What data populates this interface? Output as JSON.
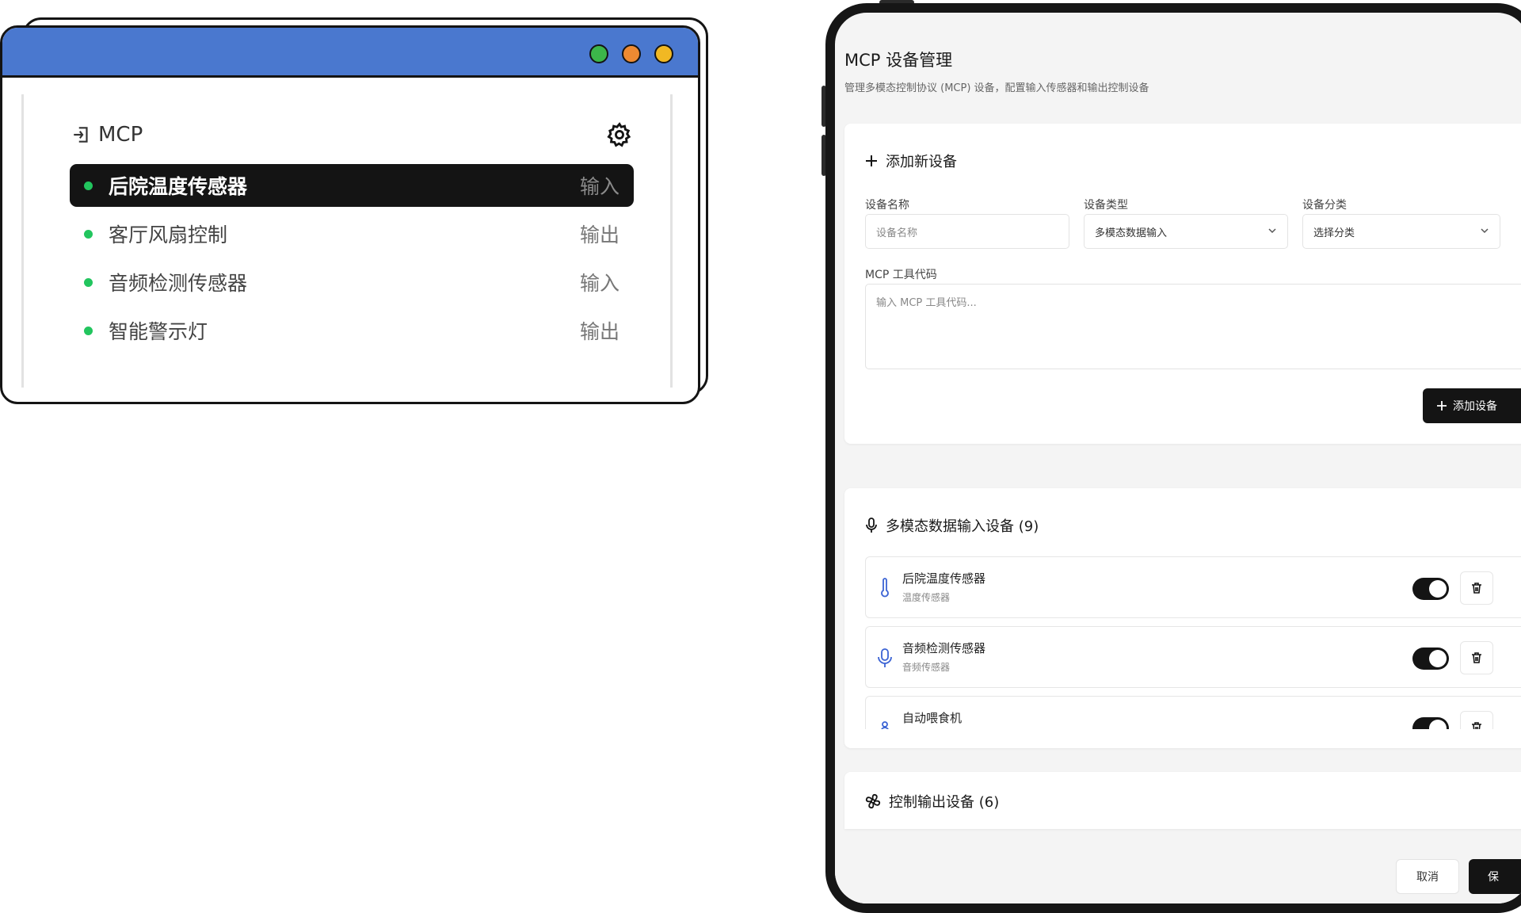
{
  "left_window": {
    "header_title": "MCP",
    "devices": [
      {
        "name": "后院温度传感器",
        "kind": "输入",
        "active": true
      },
      {
        "name": "客厅风扇控制",
        "kind": "输出",
        "active": false
      },
      {
        "name": "音频检测传感器",
        "kind": "输入",
        "active": false
      },
      {
        "name": "智能警示灯",
        "kind": "输出",
        "active": false
      }
    ],
    "status_color": "#22c55e",
    "titlebar_color": "#4a78cf"
  },
  "tablet": {
    "title": "MCP 设备管理",
    "subtitle": "管理多模态控制协议 (MCP) 设备，配置输入传感器和输出控制设备",
    "add_section": {
      "heading": "添加新设备",
      "name_label": "设备名称",
      "name_placeholder": "设备名称",
      "type_label": "设备类型",
      "type_value": "多模态数据输入",
      "category_label": "设备分类",
      "category_value": "选择分类",
      "code_label": "MCP 工具代码",
      "code_placeholder": "输入 MCP 工具代码...",
      "add_button": "添加设备"
    },
    "input_section": {
      "heading": "多模态数据输入设备 (9)",
      "items": [
        {
          "name": "后院温度传感器",
          "type": "温度传感器",
          "icon": "thermometer-icon",
          "enabled": true
        },
        {
          "name": "音频检测传感器",
          "type": "音频传感器",
          "icon": "microphone-icon",
          "enabled": true
        },
        {
          "name": "自动喂食机",
          "type": "",
          "icon": "feeder-icon",
          "enabled": true
        }
      ]
    },
    "output_section": {
      "heading": "控制输出设备 (6)"
    },
    "footer": {
      "cancel": "取消",
      "save": "保"
    }
  }
}
